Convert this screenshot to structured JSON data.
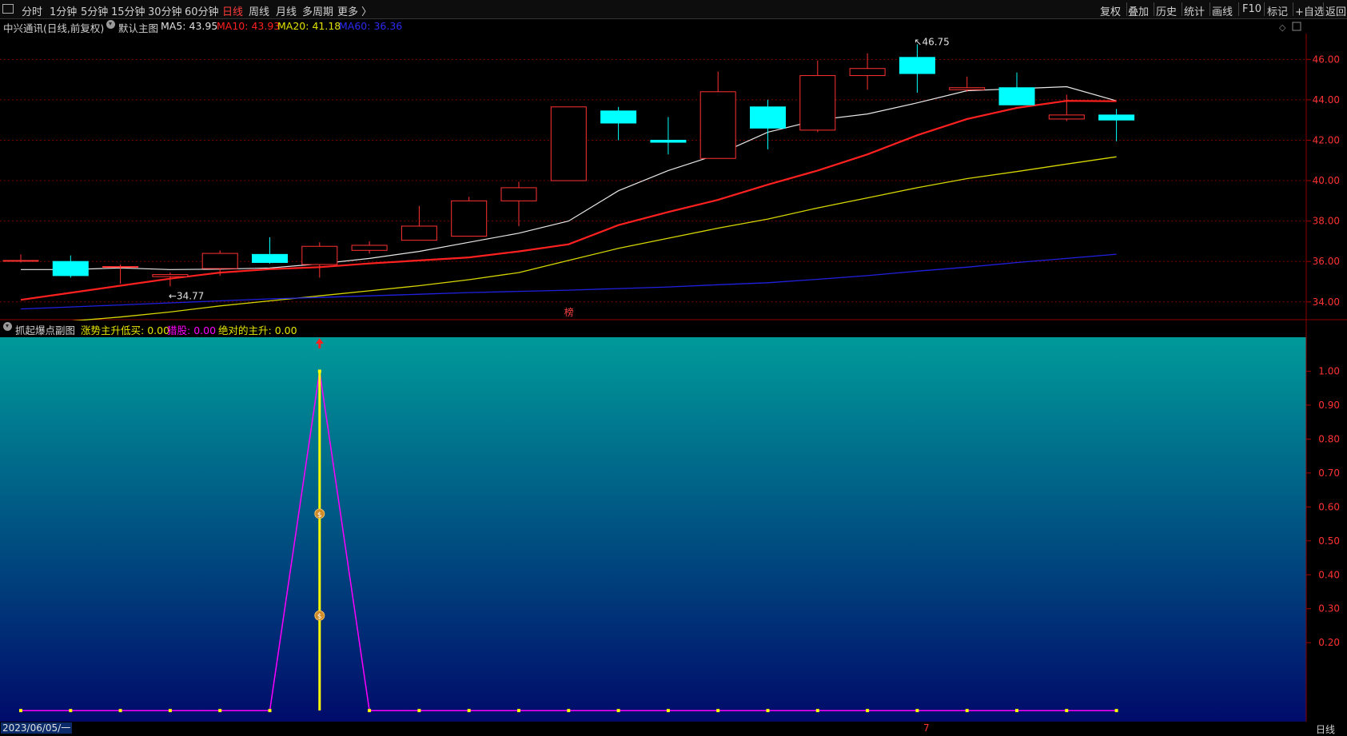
{
  "toolbar": {
    "left_items": [
      "分时",
      "1分钟",
      "5分钟",
      "15分钟",
      "30分钟",
      "60分钟",
      "日线",
      "周线",
      "月线",
      "多周期",
      "更多 〉"
    ],
    "active_item": "日线",
    "right_items": [
      "复权",
      "叠加",
      "历史",
      "统计",
      "画线",
      "F10",
      "标记",
      "+自选",
      "返回"
    ]
  },
  "main_chart_header": {
    "title": "中兴通讯(日线,前复权)",
    "template_label": "默认主图",
    "ma5_label": "MA5:",
    "ma5_value": "43.95",
    "ma10_label": "MA10:",
    "ma10_value": "43.93",
    "ma20_label": "MA20:",
    "ma20_value": "41.18",
    "ma60_label": "MA60:",
    "ma60_value": "36.36"
  },
  "sub_chart_header": {
    "title": "抓起爆点副图",
    "l1_label": "涨势主升低买:",
    "l1_value": "0.00",
    "l2_label": "猎股:",
    "l2_value": "0.00",
    "l3_label": "绝对的主升:",
    "l3_value": "0.00"
  },
  "bottom_bar": {
    "date_label": "2023/06/05/一",
    "period_label": "日线",
    "marker": "7"
  },
  "colors": {
    "up": "#ff3232",
    "down": "#00ffff",
    "ma5": "#e8e8e8",
    "ma10": "#ff2020",
    "ma20": "#d6d600",
    "ma60": "#2020e0",
    "sub_line": "#ff00ff",
    "sub_spike": "#ffff00",
    "grad_top": "#009a9a",
    "grad_bottom": "#000a6a"
  },
  "chart_data": [
    {
      "type": "candlestick",
      "title": "中兴通讯(日线,前复权)",
      "ylim": [
        33.2,
        47.2
      ],
      "y_ticks": [
        "34.00",
        "36.00",
        "38.00",
        "40.00",
        "42.00",
        "44.00",
        "46.00"
      ],
      "annotations": [
        {
          "text": "34.77",
          "label": "low",
          "price": 34.77,
          "candle": 3
        },
        {
          "text": "46.75",
          "label": "high",
          "price": 46.75,
          "candle": 18
        },
        {
          "text": "榜",
          "label": "marker",
          "candle": 11
        }
      ],
      "candles": [
        {
          "o": 36.05,
          "h": 36.35,
          "l": 35.95,
          "c": 36.05
        },
        {
          "o": 36.0,
          "h": 36.3,
          "l": 35.2,
          "c": 35.3
        },
        {
          "o": 35.75,
          "h": 35.85,
          "l": 34.9,
          "c": 35.75
        },
        {
          "o": 35.25,
          "h": 35.45,
          "l": 34.77,
          "c": 35.35
        },
        {
          "o": 35.65,
          "h": 36.55,
          "l": 35.3,
          "c": 36.4
        },
        {
          "o": 36.35,
          "h": 37.2,
          "l": 35.9,
          "c": 35.95
        },
        {
          "o": 35.85,
          "h": 36.95,
          "l": 35.2,
          "c": 36.75
        },
        {
          "o": 36.55,
          "h": 37.0,
          "l": 36.4,
          "c": 36.8
        },
        {
          "o": 37.05,
          "h": 38.75,
          "l": 37.05,
          "c": 37.75
        },
        {
          "o": 37.25,
          "h": 39.2,
          "l": 37.25,
          "c": 39.0
        },
        {
          "o": 39.0,
          "h": 39.95,
          "l": 37.75,
          "c": 39.65
        },
        {
          "o": 40.0,
          "h": 43.65,
          "l": 40.0,
          "c": 43.65
        },
        {
          "o": 43.45,
          "h": 43.65,
          "l": 42.0,
          "c": 42.85
        },
        {
          "o": 42.0,
          "h": 43.15,
          "l": 41.3,
          "c": 41.9
        },
        {
          "o": 41.1,
          "h": 45.4,
          "l": 41.1,
          "c": 44.4
        },
        {
          "o": 43.65,
          "h": 44.0,
          "l": 41.55,
          "c": 42.6
        },
        {
          "o": 42.5,
          "h": 45.95,
          "l": 42.4,
          "c": 45.2
        },
        {
          "o": 45.2,
          "h": 46.3,
          "l": 44.5,
          "c": 45.55
        },
        {
          "o": 46.1,
          "h": 46.75,
          "l": 44.35,
          "c": 45.3
        },
        {
          "o": 44.5,
          "h": 45.15,
          "l": 44.4,
          "c": 44.6
        },
        {
          "o": 44.6,
          "h": 45.35,
          "l": 43.75,
          "c": 43.75
        },
        {
          "o": 43.05,
          "h": 44.25,
          "l": 42.95,
          "c": 43.25
        },
        {
          "o": 43.25,
          "h": 43.55,
          "l": 41.95,
          "c": 43.0
        }
      ],
      "series": [
        {
          "name": "MA5",
          "values": [
            35.6,
            35.6,
            35.68,
            35.6,
            35.62,
            35.68,
            35.88,
            36.15,
            36.5,
            36.95,
            37.4,
            38.0,
            39.5,
            40.5,
            41.3,
            42.4,
            43.0,
            43.3,
            43.85,
            44.45,
            44.55,
            44.65,
            43.95
          ]
        },
        {
          "name": "MA10",
          "values": [
            34.1,
            34.45,
            34.8,
            35.15,
            35.45,
            35.62,
            35.72,
            35.9,
            36.05,
            36.2,
            36.5,
            36.85,
            37.8,
            38.45,
            39.05,
            39.8,
            40.5,
            41.3,
            42.25,
            43.05,
            43.6,
            43.95,
            43.93
          ]
        },
        {
          "name": "MA20",
          "values": [
            32.85,
            33.05,
            33.25,
            33.5,
            33.8,
            34.05,
            34.3,
            34.55,
            34.8,
            35.1,
            35.45,
            36.05,
            36.65,
            37.15,
            37.65,
            38.1,
            38.65,
            39.15,
            39.65,
            40.1,
            40.45,
            40.82,
            41.18
          ]
        },
        {
          "name": "MA60",
          "values": [
            33.65,
            33.75,
            33.85,
            33.95,
            34.05,
            34.15,
            34.22,
            34.3,
            34.38,
            34.46,
            34.52,
            34.58,
            34.66,
            34.74,
            34.85,
            34.95,
            35.12,
            35.3,
            35.52,
            35.72,
            35.95,
            36.15,
            36.36
          ]
        }
      ]
    },
    {
      "type": "line",
      "title": "抓起爆点副图",
      "ylim": [
        -0.002,
        1.1
      ],
      "y_ticks": [
        "0.20",
        "0.30",
        "0.40",
        "0.50",
        "0.60",
        "0.70",
        "0.80",
        "0.90",
        "1.00"
      ],
      "series": [
        {
          "name": "猎股",
          "values": [
            0,
            0,
            0,
            0,
            0,
            0,
            1,
            0,
            0,
            0,
            0,
            0,
            0,
            0,
            0,
            0,
            0,
            0,
            0,
            0,
            0,
            0,
            0
          ]
        }
      ],
      "signal": {
        "candle": 6,
        "from": 0,
        "to": 1
      },
      "signal_markers": [
        {
          "candle": 6,
          "y": 0.58
        },
        {
          "candle": 6,
          "y": 0.28
        }
      ]
    }
  ]
}
